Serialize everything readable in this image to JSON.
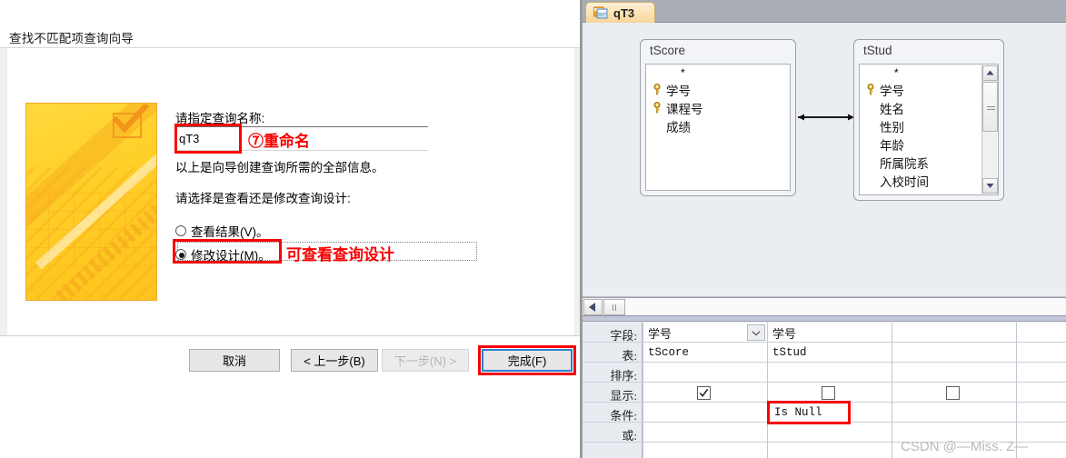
{
  "wizard": {
    "title": "查找不匹配项查询向导",
    "name_label": "请指定查询名称:",
    "name_value": "qT3",
    "info_text": "以上是向导创建查询所需的全部信息。",
    "choose_text": "请选择是查看还是修改查询设计:",
    "radio_view": "查看结果(V)。",
    "radio_design": "修改设计(M)。",
    "buttons": {
      "cancel": "取消",
      "back": "< 上一步(B)",
      "next": "下一步(N) >",
      "finish": "完成(F)"
    },
    "annotations": {
      "rename": "⑦重命名",
      "design": "可查看查询设计",
      "color": "#f80000"
    }
  },
  "access": {
    "tab_label": "qT3",
    "tab_icon": "query-icon",
    "tables": [
      {
        "name": "tScore",
        "star": "*",
        "fields": [
          {
            "label": "学号",
            "key": true
          },
          {
            "label": "课程号",
            "key": true
          },
          {
            "label": "成绩",
            "key": false
          }
        ],
        "scrollbar": false
      },
      {
        "name": "tStud",
        "star": "*",
        "fields": [
          {
            "label": "学号",
            "key": true
          },
          {
            "label": "姓名",
            "key": false
          },
          {
            "label": "性别",
            "key": false
          },
          {
            "label": "年龄",
            "key": false
          },
          {
            "label": "所属院系",
            "key": false
          },
          {
            "label": "入校时间",
            "key": false
          }
        ],
        "scrollbar": true
      }
    ],
    "grid": {
      "row_labels": [
        "字段:",
        "表:",
        "排序:",
        "显示:",
        "条件:",
        "或:"
      ],
      "columns": [
        {
          "field": "学号",
          "table": "tScore",
          "sort": "",
          "show": true,
          "criteria": "",
          "or": "",
          "has_combo": true
        },
        {
          "field": "学号",
          "table": "tStud",
          "sort": "",
          "show": false,
          "criteria": "Is Null",
          "or": "",
          "has_combo": false
        },
        {
          "field": "",
          "table": "",
          "sort": "",
          "show": false,
          "criteria": "",
          "or": "",
          "has_combo": false
        }
      ]
    },
    "watermark": "CSDN @—Miss. Z—"
  }
}
